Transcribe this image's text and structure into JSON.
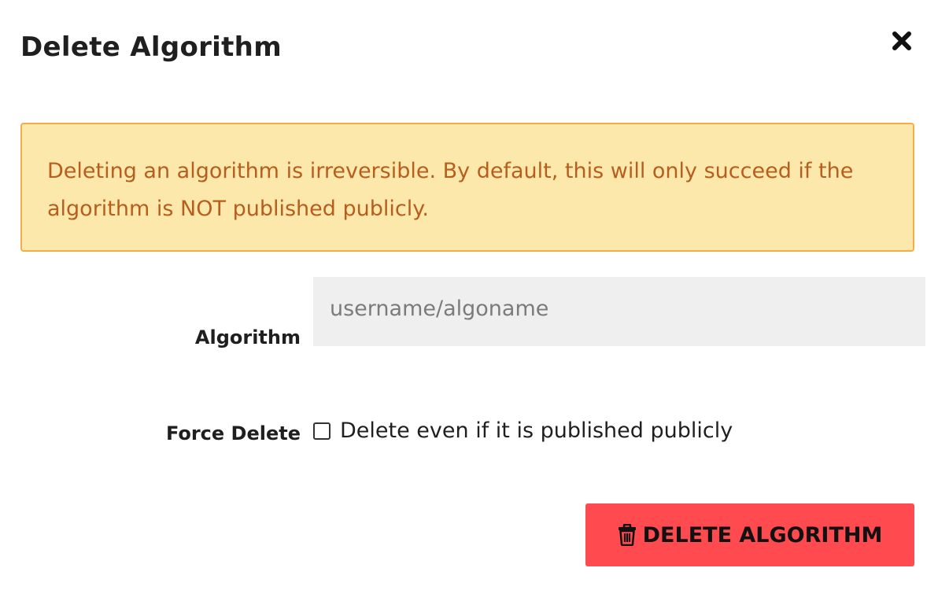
{
  "dialog": {
    "title": "Delete Algorithm",
    "close_icon": "close-x-icon"
  },
  "warning": {
    "text": "Deleting an algorithm is irreversible. By default, this will only succeed if the algorithm is NOT published publicly.",
    "background": "#fde8ab",
    "border": "#f5ad4a",
    "text_color": "#b65e1f"
  },
  "form": {
    "algorithm": {
      "label": "Algorithm",
      "value": "",
      "placeholder": "username/algoname"
    },
    "force_delete": {
      "label": "Force Delete",
      "checkbox_label": "Delete even if it is published publicly",
      "checked": false
    }
  },
  "submit": {
    "label": "DELETE ALGORITHM",
    "icon": "trash-icon",
    "color": "#ff4a4f"
  }
}
